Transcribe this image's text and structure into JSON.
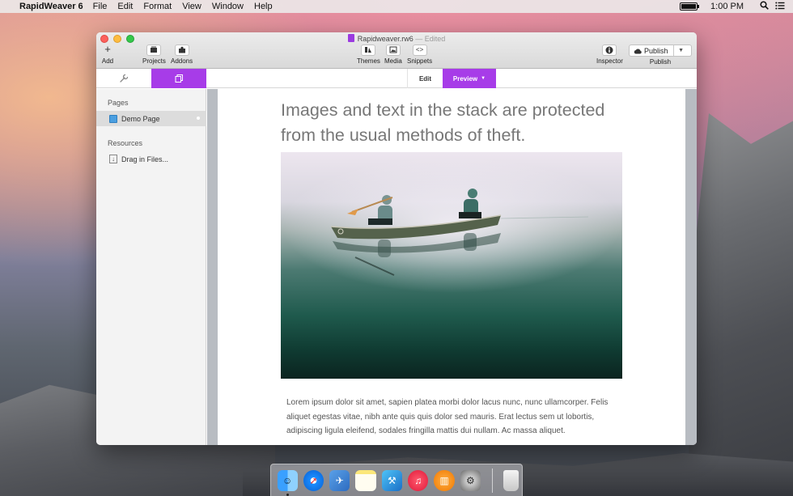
{
  "menubar": {
    "app_name": "RapidWeaver 6",
    "menus": [
      "File",
      "Edit",
      "Format",
      "View",
      "Window",
      "Help"
    ],
    "clock": "1:00 PM"
  },
  "window": {
    "document_name": "Rapidweaver.rw6",
    "edited_label": "— Edited"
  },
  "toolbar": {
    "add": "Add",
    "projects": "Projects",
    "addons": "Addons",
    "themes": "Themes",
    "media": "Media",
    "snippets": "Snippets",
    "inspector": "Inspector",
    "publish_button": "Publish",
    "publish_label": "Publish"
  },
  "modes": {
    "edit": "Edit",
    "preview": "Preview"
  },
  "sidebar": {
    "pages_title": "Pages",
    "pages": [
      {
        "label": "Demo Page"
      }
    ],
    "resources_title": "Resources",
    "resources_item": "Drag in Files..."
  },
  "preview": {
    "heading": "Images and text in the stack are protected from the usual methods of theft.",
    "body": "Lorem ipsum dolor sit amet, sapien platea morbi dolor lacus nunc, nunc ullamcorper. Felis aliquet egestas vitae, nibh ante quis quis dolor sed mauris. Erat lectus sem ut lobortis, adipiscing ligula eleifend, sodales fringilla mattis dui nullam. Ac massa aliquet."
  },
  "colors": {
    "accent": "#a73ce8"
  }
}
